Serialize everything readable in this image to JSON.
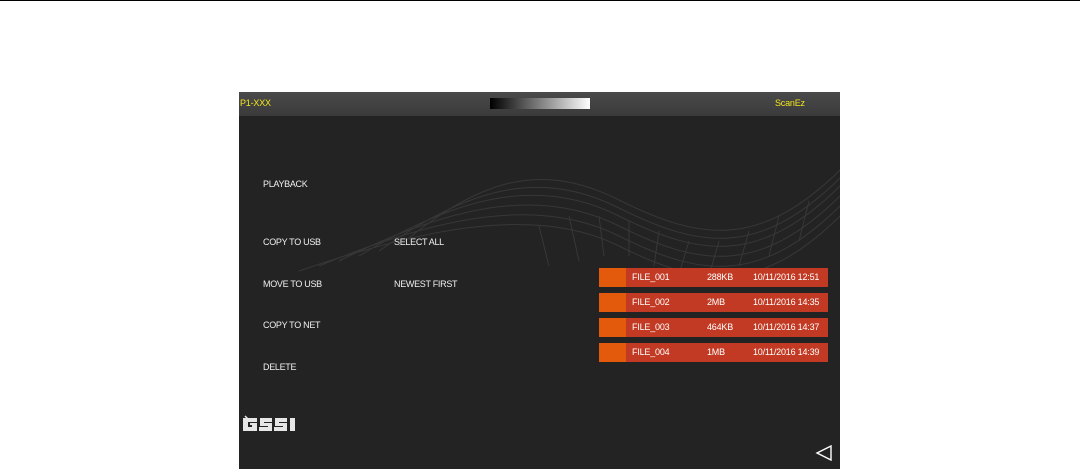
{
  "header": {
    "left_title": "P1-XXX",
    "right_title": "ScanEz"
  },
  "menu": {
    "playback": "PLAYBACK",
    "copy_to_usb": "COPY TO USB",
    "move_to_usb": "MOVE TO USB",
    "copy_to_net": "COPY TO NET",
    "delete": "DELETE",
    "select_all": "SELECT ALL",
    "newest_first": "NEWEST FIRST"
  },
  "files": [
    {
      "name": "FILE_001",
      "size": "288KB",
      "date": "10/11/2016  12:51"
    },
    {
      "name": "FILE_002",
      "size": "2MB",
      "date": "10/11/2016  14:35"
    },
    {
      "name": "FILE_003",
      "size": "464KB",
      "date": "10/11/2016  14:37"
    },
    {
      "name": "FILE_004",
      "size": "1MB",
      "date": "10/11/2016  14:39"
    }
  ],
  "logo": {
    "text": "GSSI",
    "icon": "gssi-logo"
  },
  "colors": {
    "title_text": "#f2e51c",
    "file_row": "#c23a23",
    "file_swatch": "#e35a0c",
    "screen_bg": "#232323"
  },
  "icons": {
    "back": "back-triangle-icon"
  }
}
